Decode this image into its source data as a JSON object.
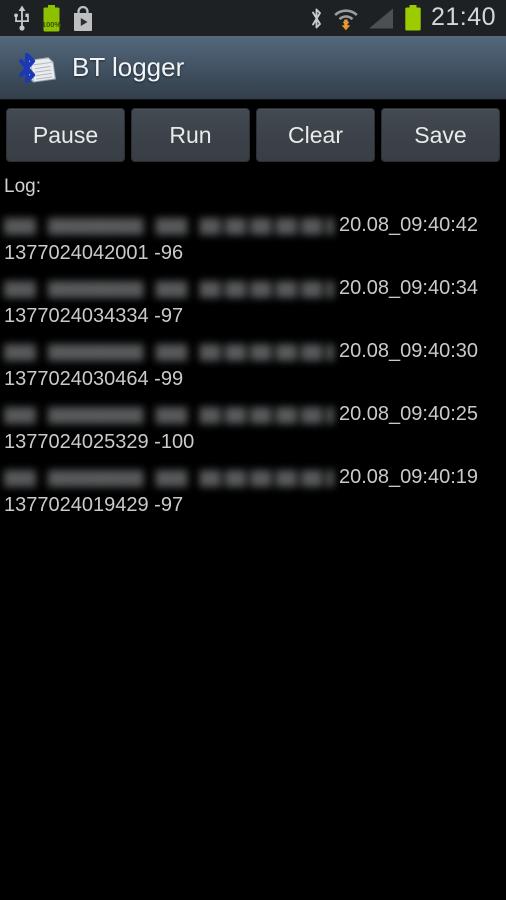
{
  "statusbar": {
    "time": "21:40",
    "battery_percent_label": "100%",
    "left_icons": [
      {
        "name": "usb-icon",
        "label": "USB"
      },
      {
        "name": "battery-charging-icon",
        "label": "100%"
      },
      {
        "name": "play-store-icon",
        "label": "Play Store"
      }
    ],
    "right_icons": [
      {
        "name": "bluetooth-icon",
        "label": "Bluetooth"
      },
      {
        "name": "wifi-download-icon",
        "label": "Wi-Fi"
      },
      {
        "name": "cellular-signal-icon",
        "label": "Signal"
      },
      {
        "name": "battery-icon",
        "label": "Battery"
      }
    ]
  },
  "titlebar": {
    "title": "BT logger",
    "icon": "bt-logger-app-icon"
  },
  "toolbar": {
    "buttons": [
      {
        "name": "pause-button",
        "label": "Pause"
      },
      {
        "name": "run-button",
        "label": "Run"
      },
      {
        "name": "clear-button",
        "label": "Clear"
      },
      {
        "name": "save-button",
        "label": "Save"
      }
    ]
  },
  "log": {
    "label": "Log:",
    "redacted_placeholder_1": "███",
    "redacted_placeholder_2": "█████████",
    "redacted_placeholder_3": "███",
    "redacted_placeholder_4": "██ ██ ██ ██ ██ ██",
    "entries": [
      {
        "timestamp": "20.08_09:40:42",
        "data": "1377024042001  -96"
      },
      {
        "timestamp": "20.08_09:40:34",
        "data": "1377024034334  -97"
      },
      {
        "timestamp": "20.08_09:40:30",
        "data": "1377024030464  -99"
      },
      {
        "timestamp": "20.08_09:40:25",
        "data": "1377024025329  -100"
      },
      {
        "timestamp": "20.08_09:40:19",
        "data": "1377024019429  -97"
      }
    ]
  },
  "colors": {
    "background": "#000000",
    "statusbar_bg": "#1e2124",
    "titlebar_top": "#54697d",
    "titlebar_bottom": "#333e4a",
    "button_bg": "#3c4249",
    "text_primary": "#c8cacc",
    "battery_green": "#99cc00",
    "bluetooth_blue": "#1b39b5",
    "wifi_orange": "#f0972a"
  }
}
